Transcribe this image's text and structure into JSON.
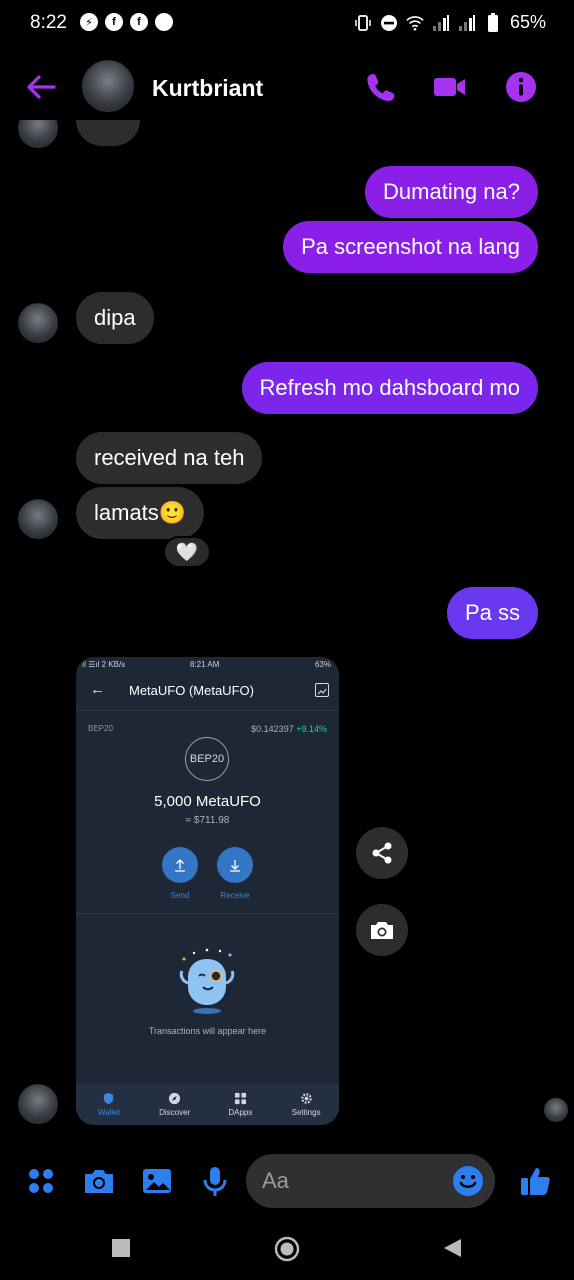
{
  "status_bar": {
    "time": "8:22",
    "battery": "65%",
    "notification_icons": [
      "messenger-icon",
      "facebook-icon",
      "facebook-icon",
      "circle-icon"
    ]
  },
  "header": {
    "contact_name": "Kurtbriant",
    "accent_color": "#9b2ff0"
  },
  "messages": [
    {
      "direction": "outgoing",
      "text": "Dumating na?"
    },
    {
      "direction": "outgoing",
      "text": "Pa screenshot na lang"
    },
    {
      "direction": "incoming",
      "text": "dipa"
    },
    {
      "direction": "outgoing",
      "text": "Refresh mo dahsboard mo"
    },
    {
      "direction": "incoming",
      "text": "received na teh"
    },
    {
      "direction": "incoming",
      "text": "lamats🙂",
      "reaction": "🤍"
    },
    {
      "direction": "outgoing",
      "text": "Pa ss"
    }
  ],
  "shared_screenshot": {
    "status_left": "ıl ☰ıl 2 KB/s",
    "status_time": "8:21 AM",
    "status_right": "63%",
    "title": "MetaUFO (MetaUFO)",
    "network": "BEP20",
    "price": "$0.142397",
    "change": "+9.14%",
    "token_badge": "BEP20",
    "balance": "5,000 MetaUFO",
    "fiat": "≈ $711.98",
    "send_label": "Send",
    "receive_label": "Receive",
    "empty_text": "Transactions will appear here",
    "nav": [
      "Wallet",
      "Discover",
      "DApps",
      "Settings"
    ]
  },
  "composer": {
    "placeholder": "Aa",
    "icon_color": "#2d7ff0"
  }
}
